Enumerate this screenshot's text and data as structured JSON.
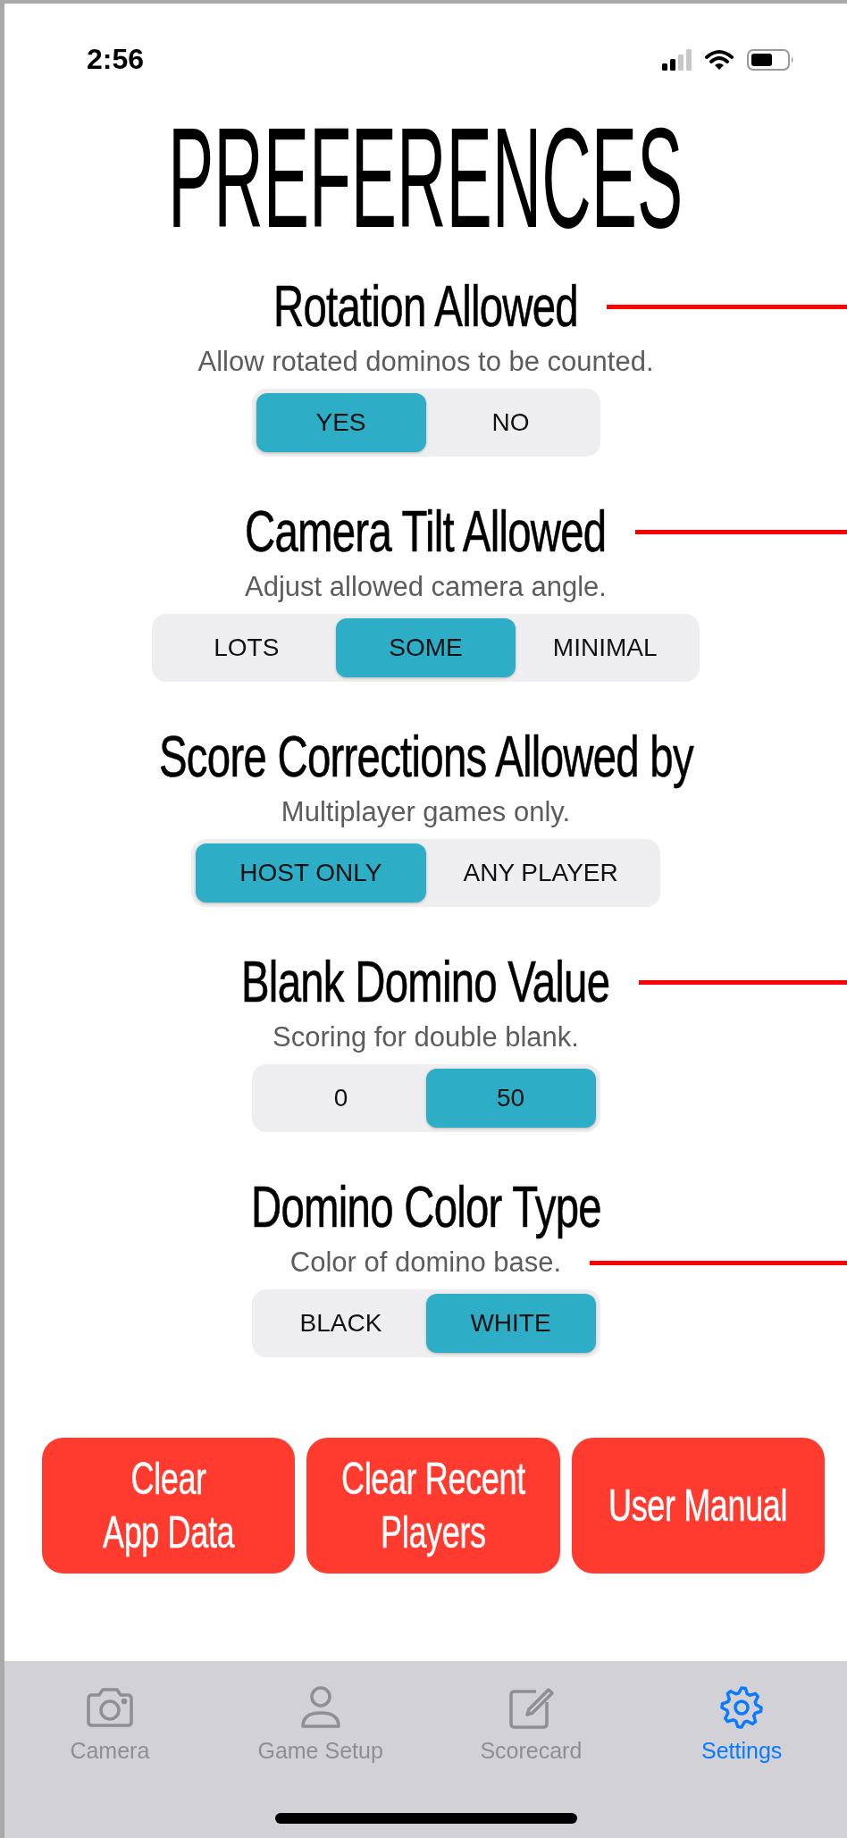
{
  "status_bar": {
    "time": "2:56"
  },
  "title": "PREFERENCES",
  "sections": [
    {
      "title": "Rotation Allowed",
      "description": "Allow rotated dominos to be counted.",
      "pointer_at_title": true,
      "pointer_at_description": false,
      "options": [
        {
          "label": "YES",
          "selected": true
        },
        {
          "label": "NO",
          "selected": false
        }
      ]
    },
    {
      "title": "Camera Tilt Allowed",
      "description": "Adjust allowed camera angle.",
      "pointer_at_title": true,
      "pointer_at_description": false,
      "options": [
        {
          "label": "LOTS",
          "selected": false
        },
        {
          "label": "SOME",
          "selected": true
        },
        {
          "label": "MINIMAL",
          "selected": false
        }
      ]
    },
    {
      "title": "Score Corrections Allowed by",
      "description": "Multiplayer games only.",
      "pointer_at_title": false,
      "pointer_at_description": false,
      "options": [
        {
          "label": "HOST ONLY",
          "selected": true
        },
        {
          "label": "ANY PLAYER",
          "selected": false
        }
      ]
    },
    {
      "title": "Blank Domino Value",
      "description": "Scoring for double blank.",
      "pointer_at_title": true,
      "pointer_at_description": false,
      "options": [
        {
          "label": "0",
          "selected": false
        },
        {
          "label": "50",
          "selected": true
        }
      ]
    },
    {
      "title": "Domino Color Type",
      "description": "Color of domino base.",
      "pointer_at_title": false,
      "pointer_at_description": true,
      "options": [
        {
          "label": "BLACK",
          "selected": false
        },
        {
          "label": "WHITE",
          "selected": true
        }
      ]
    }
  ],
  "actions": [
    {
      "label": "Clear\nApp Data"
    },
    {
      "label": "Clear Recent\nPlayers"
    },
    {
      "label": "User Manual"
    }
  ],
  "tab_bar": [
    {
      "label": "Camera",
      "selected": false
    },
    {
      "label": "Game Setup",
      "selected": false
    },
    {
      "label": "Scorecard",
      "selected": false
    },
    {
      "label": "Settings",
      "selected": true
    }
  ]
}
